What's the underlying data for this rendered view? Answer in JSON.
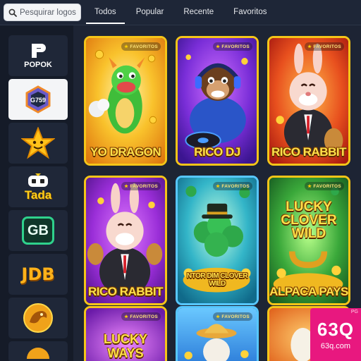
{
  "search": {
    "placeholder": "Pesquirar logos",
    "icon": "search-icon"
  },
  "tabs": [
    {
      "label": "Todos",
      "active": true
    },
    {
      "label": "Popular",
      "active": false
    },
    {
      "label": "Recente",
      "active": false
    },
    {
      "label": "Favoritos",
      "active": false
    }
  ],
  "sidebar": {
    "providers": [
      {
        "name": "POPOK",
        "logo_text": "POPOK",
        "selected": false
      },
      {
        "name": "G759",
        "logo_text": "G759",
        "selected": true
      },
      {
        "name": "star",
        "logo_text": "",
        "selected": false
      },
      {
        "name": "Tada",
        "logo_text": "Tada",
        "selected": false
      },
      {
        "name": "GB",
        "logo_text": "GB",
        "selected": false
      },
      {
        "name": "JDB",
        "logo_text": "JDB",
        "selected": false
      },
      {
        "name": "dragon",
        "logo_text": "",
        "selected": false
      }
    ]
  },
  "games": [
    {
      "title": "YO DRAGON",
      "badge": "FAVORITOS"
    },
    {
      "title": "RICO DJ",
      "badge": "FAVORITOS"
    },
    {
      "title": "RICO RABBIT",
      "badge": "FAVORITOS"
    },
    {
      "title": "RICO RABBIT",
      "badge": "FAVORITOS"
    },
    {
      "title": "NTOR DIM CLOVER WILD",
      "badge": "FAVORITOS",
      "art_text": "NTOR DIM CLOVER WILD"
    },
    {
      "title": "ALPACA PAYS",
      "badge": "FAVORITOS",
      "art_text": "LUCKY CLOVER WILD"
    },
    {
      "title": "",
      "badge": "FAVORITOS",
      "art_text": "LUCKY WAYS"
    },
    {
      "title": "",
      "badge": "FAVORITOS"
    },
    {
      "title": "",
      "badge": ""
    }
  ],
  "watermark": {
    "big": "63Q",
    "small": "63q.com",
    "tag": "PG"
  },
  "colors": {
    "card_border": "#f5c518",
    "title_yellow": "#ffe14a",
    "watermark_pink": "#e8187f"
  }
}
